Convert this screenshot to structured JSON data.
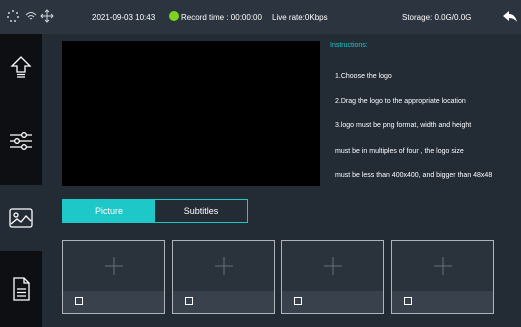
{
  "status": {
    "datetime": "2021-09-03 10:43",
    "record_time": "Record time : 00:00:00",
    "live_rate": "Live rate:0Kbps",
    "storage": "Storage: 0.0G/0.0G",
    "icons": [
      "loading-icon",
      "wifi-icon",
      "network-icon",
      "record-dot-icon",
      "back-icon"
    ],
    "record_color": "#7ed321"
  },
  "sidebar": {
    "items": [
      {
        "icon": "upload-icon",
        "active": false
      },
      {
        "icon": "sliders-icon",
        "active": false
      },
      {
        "icon": "image-icon",
        "active": true
      },
      {
        "icon": "document-icon",
        "active": false
      }
    ]
  },
  "instructions": {
    "title": "Instructions:",
    "lines": [
      "1.Choose the logo",
      "2.Drag the logo to the appropriate location",
      "3.logo must be png format, width and height",
      "must be in multiples of four ,  the logo size",
      "must be less than 400x400, and bigger than 48x48"
    ]
  },
  "tabs": {
    "picture": "Picture",
    "subtitles": "Subtitles",
    "active": "picture"
  },
  "logo_slots": [
    {
      "checked": false
    },
    {
      "checked": false
    },
    {
      "checked": false
    },
    {
      "checked": false
    }
  ],
  "colors": {
    "accent": "#1ec8c8",
    "background": "#232b35",
    "sidebar": "#0d0f13"
  }
}
